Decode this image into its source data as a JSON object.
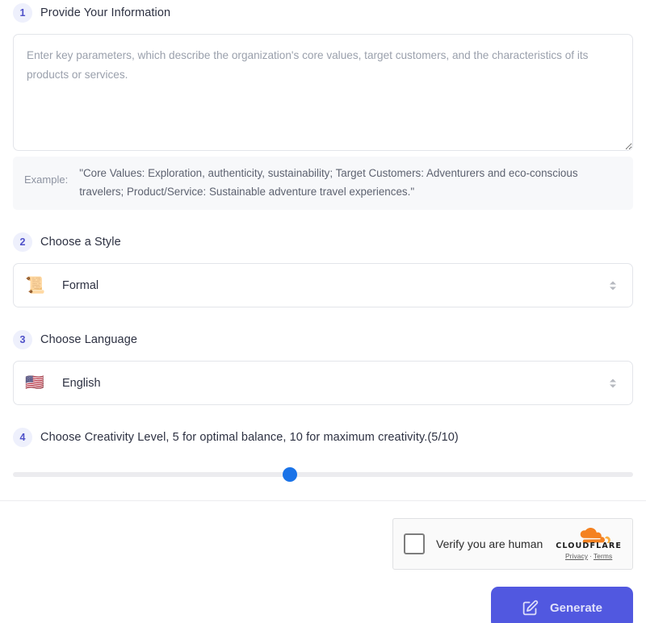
{
  "steps": [
    {
      "number": "1",
      "title": "Provide Your Information"
    },
    {
      "number": "2",
      "title": "Choose a Style"
    },
    {
      "number": "3",
      "title": "Choose Language"
    },
    {
      "number": "4",
      "title": "Choose Creativity Level, 5 for optimal balance, 10 for maximum creativity.(5/10)"
    }
  ],
  "information": {
    "value": "",
    "placeholder": "Enter key parameters, which describe the organization's core values, target customers, and the characteristics of its products or services.",
    "example_label": "Example:",
    "example_text": "\"Core Values: Exploration, authenticity, sustainability; Target Customers: Adventurers and eco-conscious travelers; Product/Service: Sustainable adventure travel experiences.\""
  },
  "style_select": {
    "icon": "scroll-emoji",
    "emoji": "📜",
    "value": "Formal"
  },
  "language_select": {
    "icon": "flag-us-emoji",
    "emoji": "🇺🇸",
    "value": "English"
  },
  "creativity": {
    "value": 5,
    "min": 1,
    "max": 10,
    "display": "(5/10)",
    "thumb_percent": 44.6,
    "thumb_color": "#1a73e8",
    "track_color": "#ececef"
  },
  "turnstile": {
    "checkbox_label": "Verify you are human",
    "checked": false,
    "brand": "CLOUDFLARE",
    "privacy_link": "Privacy",
    "separator": "·",
    "terms_link": "Terms",
    "logo_color": "#f48120"
  },
  "generate_button": {
    "label": "Generate",
    "icon": "edit-square-icon",
    "color": "#5158e0"
  },
  "theme": {
    "accent": "#5158e0",
    "badge_bg": "#eef0fc",
    "badge_text": "#4f51c9",
    "border": "#e3e5ea",
    "text": "#2d3142",
    "muted": "#9aa0ac"
  }
}
